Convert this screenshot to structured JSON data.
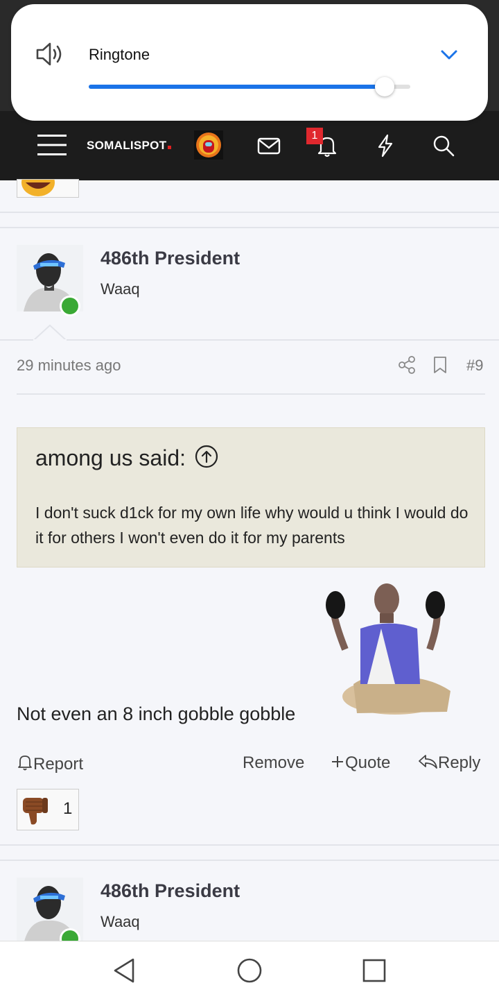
{
  "volume": {
    "label": "Ringtone",
    "level": 0.92,
    "accent_color": "#1a73e8",
    "icon": "speaker-icon",
    "expand_icon": "chevron-down-icon"
  },
  "navbar": {
    "brand": "SOMALISPOT",
    "menu_icon": "hamburger-icon",
    "icons": [
      "mail-icon",
      "bell-icon",
      "lightning-icon",
      "search-icon"
    ],
    "notification_count": "1",
    "badge_color": "#e0282e"
  },
  "posts": [
    {
      "username": "486th President",
      "user_title": "Waaq",
      "time": "29 minutes ago",
      "post_number": "#9",
      "quote": {
        "author": "among us said:",
        "text": "I don't suck d1ck for my own life why would u think I would do it for others I won't even do it for my parents"
      },
      "body": "Not even an 8 inch gobble gobble",
      "actions": {
        "report": "Report",
        "remove": "Remove",
        "quote": "Quote",
        "reply": "Reply"
      },
      "reaction": {
        "icon": "thumbs-down-icon",
        "count": "1"
      }
    },
    {
      "username": "486th President",
      "user_title": "Waaq"
    }
  ]
}
